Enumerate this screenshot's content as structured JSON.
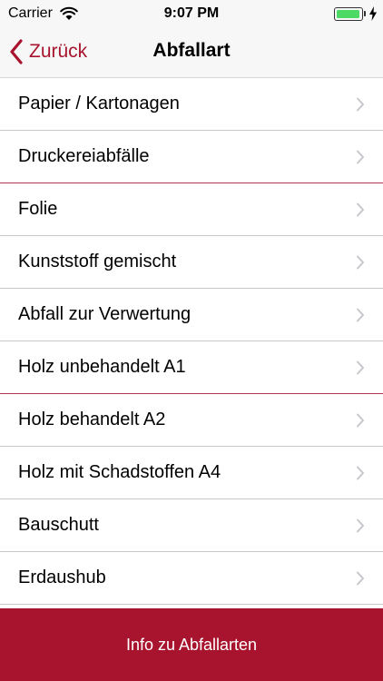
{
  "status_bar": {
    "carrier": "Carrier",
    "time": "9:07 PM",
    "battery_level": 1.0,
    "battery_color": "#4cd964"
  },
  "nav": {
    "back_label": "Zurück",
    "title": "Abfallart",
    "accent_color": "#a8142e"
  },
  "list": {
    "items": [
      {
        "label": "Papier / Kartonagen"
      },
      {
        "label": "Druckereiabfälle"
      },
      {
        "label": "Folie"
      },
      {
        "label": "Kunststoff gemischt"
      },
      {
        "label": "Abfall zur Verwertung"
      },
      {
        "label": "Holz unbehandelt A1"
      },
      {
        "label": "Holz behandelt A2"
      },
      {
        "label": "Holz mit Schadstoffen A4"
      },
      {
        "label": "Bauschutt"
      },
      {
        "label": "Erdaushub"
      }
    ],
    "chevron_icon": "chevron-right-icon"
  },
  "footer": {
    "info_button_label": "Info zu Abfallarten",
    "button_color": "#a8142e"
  }
}
